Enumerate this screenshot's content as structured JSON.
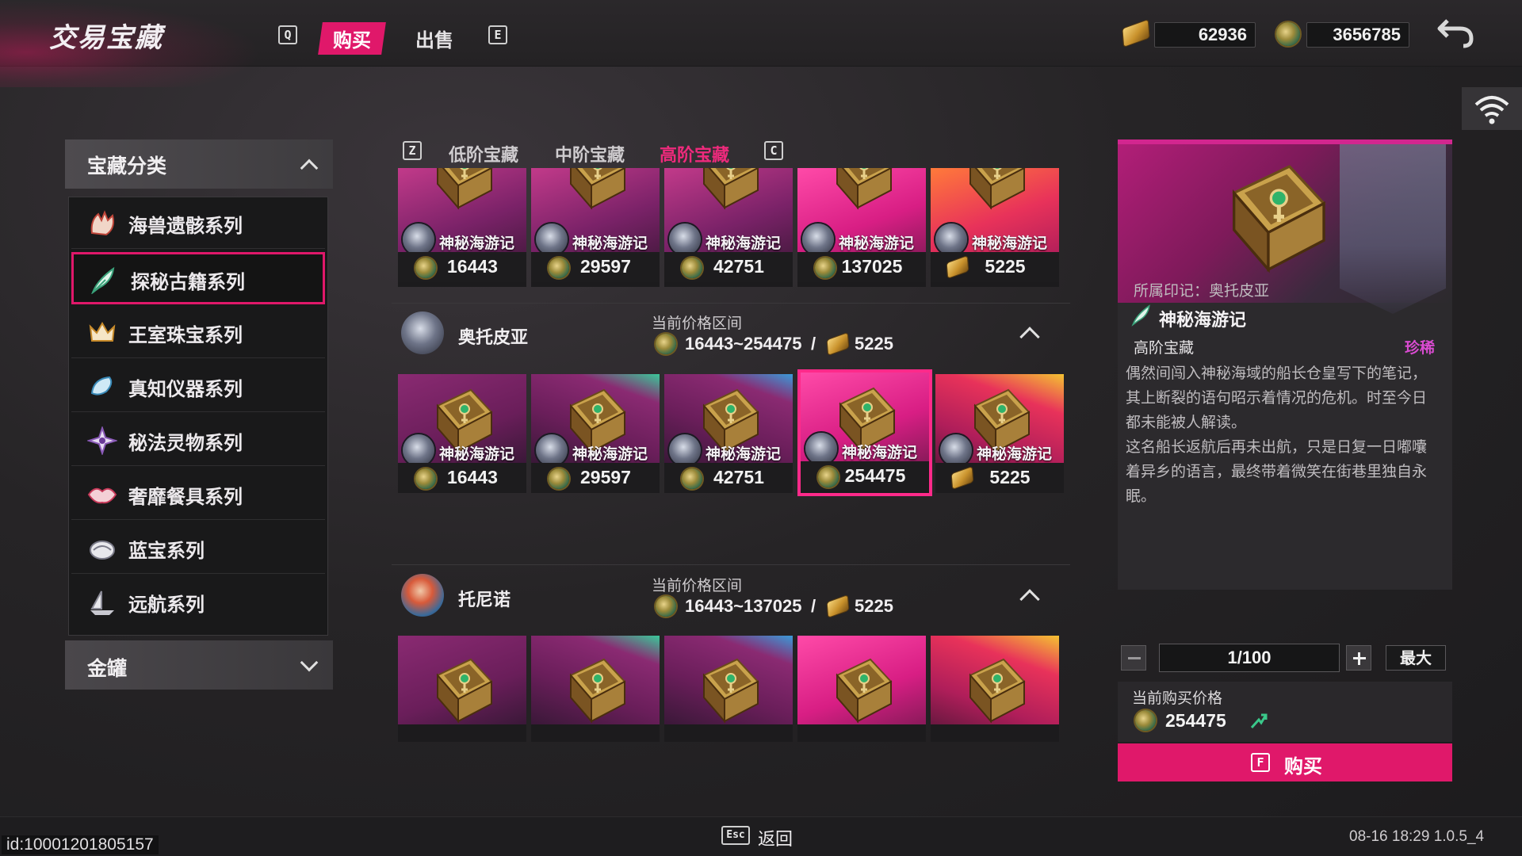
{
  "header": {
    "title": "交易宝藏",
    "key_left": "Q",
    "key_right": "E",
    "tabs": [
      {
        "label": "购买",
        "active": true
      },
      {
        "label": "出售",
        "active": false
      }
    ],
    "gold_amount": "62936",
    "coin_amount": "3656785"
  },
  "sidebar": {
    "category_title": "宝藏分类",
    "items": [
      {
        "label": "海兽遗骸系列",
        "icon": "claw-icon"
      },
      {
        "label": "探秘古籍系列",
        "icon": "quill-icon",
        "active": true
      },
      {
        "label": "王室珠宝系列",
        "icon": "crown-icon"
      },
      {
        "label": "真知仪器系列",
        "icon": "crystal-icon"
      },
      {
        "label": "秘法灵物系列",
        "icon": "star-eye-icon"
      },
      {
        "label": "奢靡餐具系列",
        "icon": "lips-icon"
      },
      {
        "label": "蓝宝系列",
        "icon": "shell-icon"
      },
      {
        "label": "远航系列",
        "icon": "ship-icon"
      }
    ],
    "jar_title": "金罐"
  },
  "tiers": {
    "key_left": "Z",
    "key_right": "C",
    "tabs": [
      {
        "label": "低阶宝藏"
      },
      {
        "label": "中阶宝藏"
      },
      {
        "label": "高阶宝藏",
        "active": true
      }
    ]
  },
  "grid": {
    "item_name": "神秘海游记",
    "top_row": [
      {
        "price": "16443",
        "currency": "coin"
      },
      {
        "price": "29597",
        "currency": "coin"
      },
      {
        "price": "42751",
        "currency": "coin"
      },
      {
        "price": "137025",
        "currency": "coin"
      },
      {
        "price": "5225",
        "currency": "gold"
      }
    ],
    "groups": [
      {
        "name": "奥托皮亚",
        "range_label": "当前价格区间",
        "range": "16443~254475",
        "sep": "/",
        "gold_price": "5225",
        "items": [
          {
            "price": "16443",
            "currency": "coin"
          },
          {
            "price": "29597",
            "currency": "coin"
          },
          {
            "price": "42751",
            "currency": "coin"
          },
          {
            "price": "254475",
            "currency": "coin",
            "selected": true
          },
          {
            "price": "5225",
            "currency": "gold"
          }
        ]
      },
      {
        "name": "托尼诺",
        "range_label": "当前价格区间",
        "range": "16443~137025",
        "sep": "/",
        "gold_price": "5225"
      }
    ]
  },
  "detail": {
    "imprint": "所属印记：奥托皮亚",
    "name": "神秘海游记",
    "tier": "高阶宝藏",
    "rarity": "珍稀",
    "desc1": "偶然间闯入神秘海域的船长仓皇写下的笔记，其上断裂的语句昭示着情况的危机。时至今日都未能被人解读。",
    "desc2": "这名船长返航后再未出航，只是日复一日嘟囔着异乡的语言，最终带着微笑在街巷里独自永眠。",
    "qty": "1/100",
    "max_label": "最大",
    "price_label": "当前购买价格",
    "price": "254475",
    "buy_key": "F",
    "buy_label": "购买"
  },
  "footer": {
    "id_text": "id:10001201805157",
    "esc_key": "Esc",
    "back_label": "返回",
    "version": "08-16 18:29 1.0.5_4"
  },
  "colors": {
    "accent": "#e0186a",
    "rarity": "#d94bd0",
    "selection": "#ff2a8a"
  }
}
